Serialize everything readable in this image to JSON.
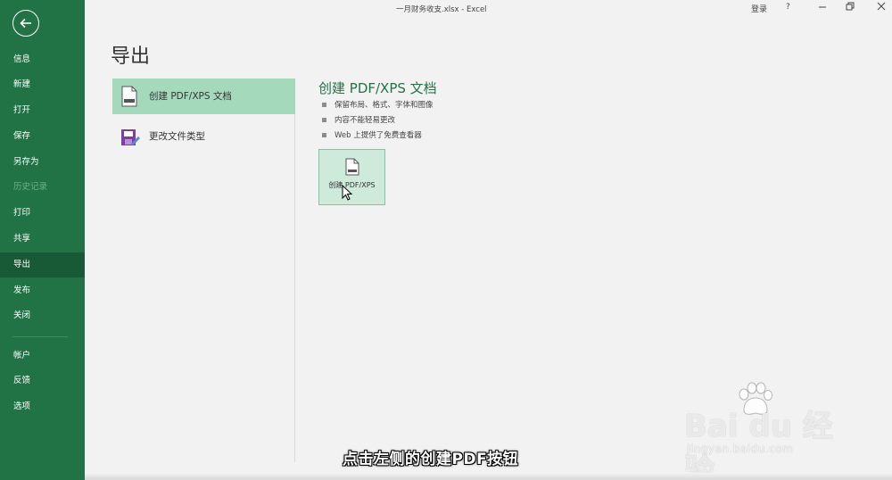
{
  "window": {
    "title": "一月财务收支.xlsx  -  Excel",
    "signin": "登录",
    "help": "?",
    "restore_icon": "restore-icon"
  },
  "sidebar": {
    "back_icon": "back-arrow-icon",
    "items": [
      {
        "label": "信息",
        "state": "normal"
      },
      {
        "label": "新建",
        "state": "normal"
      },
      {
        "label": "打开",
        "state": "normal"
      },
      {
        "label": "保存",
        "state": "normal"
      },
      {
        "label": "另存为",
        "state": "normal"
      },
      {
        "label": "历史记录",
        "state": "disabled"
      },
      {
        "label": "打印",
        "state": "normal"
      },
      {
        "label": "共享",
        "state": "normal"
      },
      {
        "label": "导出",
        "state": "active"
      },
      {
        "label": "发布",
        "state": "normal"
      },
      {
        "label": "关闭",
        "state": "normal"
      },
      {
        "label": "帐户",
        "state": "normal"
      },
      {
        "label": "反馈",
        "state": "normal"
      },
      {
        "label": "选项",
        "state": "normal"
      }
    ]
  },
  "main": {
    "title": "导出",
    "options": [
      {
        "label": "创建 PDF/XPS 文档",
        "selected": true,
        "icon": "pdf-document-icon"
      },
      {
        "label": "更改文件类型",
        "selected": false,
        "icon": "change-file-type-icon"
      }
    ],
    "detail": {
      "title": "创建 PDF/XPS 文档",
      "bullets": [
        "保留布局、格式、字体和图像",
        "内容不能轻易更改",
        "Web 上提供了免费查看器"
      ],
      "button_label": "创建 PDF/XPS"
    }
  },
  "overlay": {
    "subtitle": "点击左侧的创建PDF按钮",
    "watermark_logo": "Bai du 经验",
    "watermark_url": "jingyan.baidu.com"
  },
  "colors": {
    "accent": "#217346",
    "selected": "#a4d9bc",
    "button": "#cdeadb"
  }
}
